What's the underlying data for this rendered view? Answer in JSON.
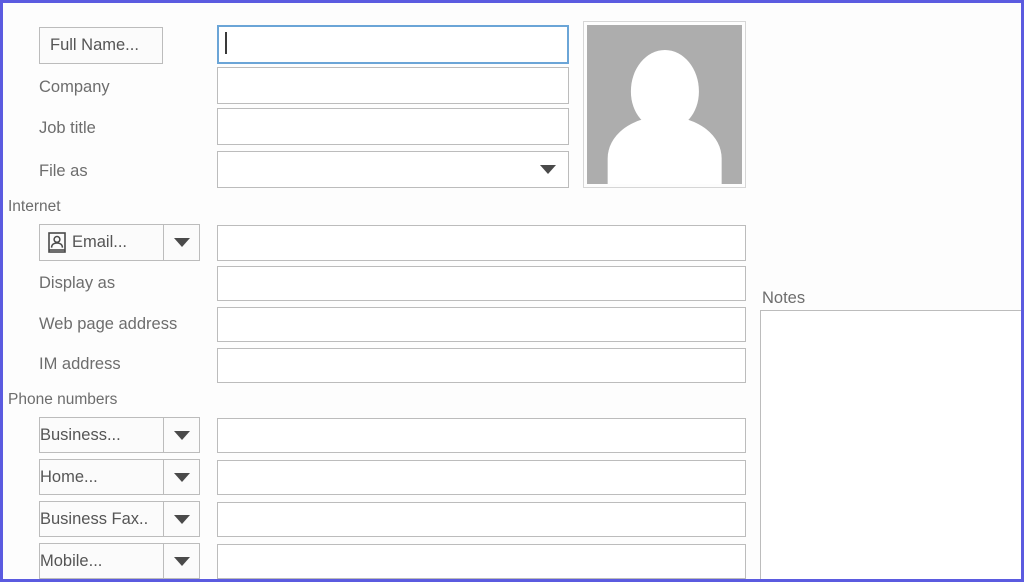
{
  "window": {
    "accent_border_color": "#5b5be0",
    "background_color": "#fdfdfd",
    "focus_border_color": "#6ba5d7",
    "field_border_color": "#bcbcbc",
    "label_color": "#6d6d6d",
    "photo_placeholder_color": "#adadad"
  },
  "contact_form": {
    "top_fields": [
      {
        "label": "Full Name...",
        "control": "button",
        "value": "",
        "focused": true
      },
      {
        "label": "Company",
        "control": "label",
        "value": ""
      },
      {
        "label": "Job title",
        "control": "label",
        "value": ""
      },
      {
        "label": "File as",
        "control": "combo",
        "value": ""
      }
    ],
    "internet": {
      "section_label": "Internet",
      "rows": [
        {
          "label": "Email...",
          "control": "split-button",
          "icon": "contact-card-icon",
          "value": ""
        },
        {
          "label": "Display as",
          "control": "label",
          "value": ""
        },
        {
          "label": "Web page address",
          "control": "label",
          "value": ""
        },
        {
          "label": "IM address",
          "control": "label",
          "value": ""
        }
      ]
    },
    "phone_numbers": {
      "section_label": "Phone numbers",
      "rows": [
        {
          "label": "Business...",
          "control": "split-button",
          "value": ""
        },
        {
          "label": "Home...",
          "control": "split-button",
          "value": ""
        },
        {
          "label": "Business Fax..",
          "control": "split-button",
          "value": ""
        },
        {
          "label": "Mobile...",
          "control": "split-button",
          "value": ""
        }
      ]
    },
    "notes": {
      "label": "Notes",
      "value": ""
    },
    "photo": {
      "alt_label": "contact-photo-placeholder"
    }
  }
}
